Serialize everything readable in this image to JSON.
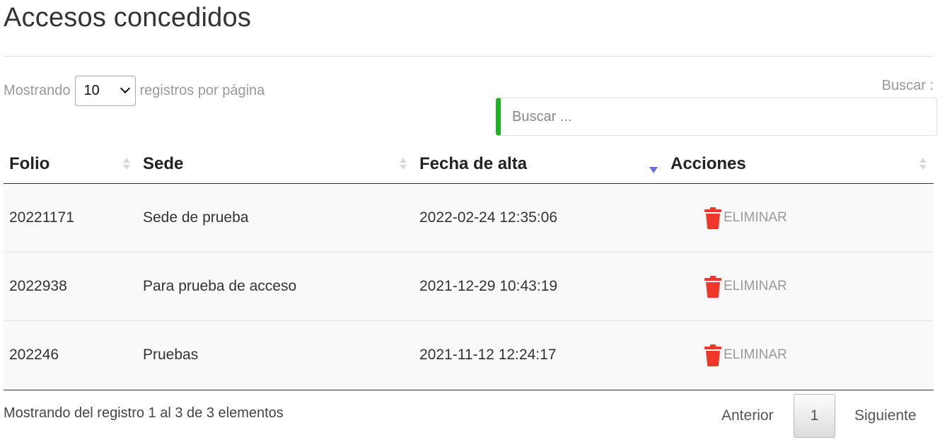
{
  "page": {
    "title": "Accesos concedidos"
  },
  "length": {
    "prefix": "Mostrando",
    "value": "10",
    "suffix": "registros por página"
  },
  "search": {
    "label": "Buscar :",
    "placeholder": "Buscar ..."
  },
  "table": {
    "columns": [
      {
        "label": "Folio",
        "sort": "none"
      },
      {
        "label": "Sede",
        "sort": "none"
      },
      {
        "label": "Fecha de alta",
        "sort": "desc"
      },
      {
        "label": "Acciones",
        "sort": "none"
      }
    ],
    "rows": [
      {
        "folio": "20221171",
        "sede": "Sede de prueba",
        "fecha": "2022-02-24 12:35:06",
        "action": "ELIMINAR"
      },
      {
        "folio": "2022938",
        "sede": "Para prueba de acceso",
        "fecha": "2021-12-29 10:43:19",
        "action": "ELIMINAR"
      },
      {
        "folio": "202246",
        "sede": "Pruebas",
        "fecha": "2021-11-12 12:24:17",
        "action": "ELIMINAR"
      }
    ],
    "action_icon": "trash-icon"
  },
  "footer": {
    "info": "Mostrando del registro 1 al 3 de 3 elementos"
  },
  "pagination": {
    "prev": "Anterior",
    "current": "1",
    "next": "Siguiente"
  },
  "colors": {
    "accent_green": "#1fb31f",
    "delete_red": "#f0362b",
    "sort_active": "#6d6fd8",
    "row_bg": "#f9f9f9"
  }
}
